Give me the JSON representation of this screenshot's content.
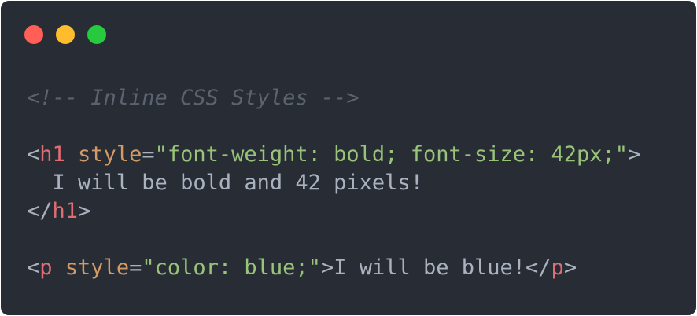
{
  "colors": {
    "window_bg": "#282c34",
    "close": "#ff5f56",
    "minimize": "#ffbd2e",
    "maximize": "#27c93f",
    "text": "#abb2bf",
    "comment": "#5c6370",
    "tag": "#e06c75",
    "attr": "#d19a66",
    "string": "#98c379"
  },
  "window_controls": {
    "close": "close-button",
    "minimize": "minimize-button",
    "maximize": "maximize-button"
  },
  "code": {
    "comment": "<!-- Inline CSS Styles -->",
    "h1_open": {
      "lt": "<",
      "tag": "h1",
      "space": " ",
      "attr": "style",
      "eq": "=",
      "value": "\"font-weight: bold; font-size: 42px;\"",
      "gt": ">"
    },
    "h1_content": "  I will be bold and 42 pixels!",
    "h1_close": {
      "lt": "</",
      "tag": "h1",
      "gt": ">"
    },
    "p_line": {
      "lt": "<",
      "tag": "p",
      "space": " ",
      "attr": "style",
      "eq": "=",
      "value": "\"color: blue;\"",
      "gt": ">",
      "content": "I will be blue!",
      "close_lt": "</",
      "close_tag": "p",
      "close_gt": ">"
    }
  }
}
